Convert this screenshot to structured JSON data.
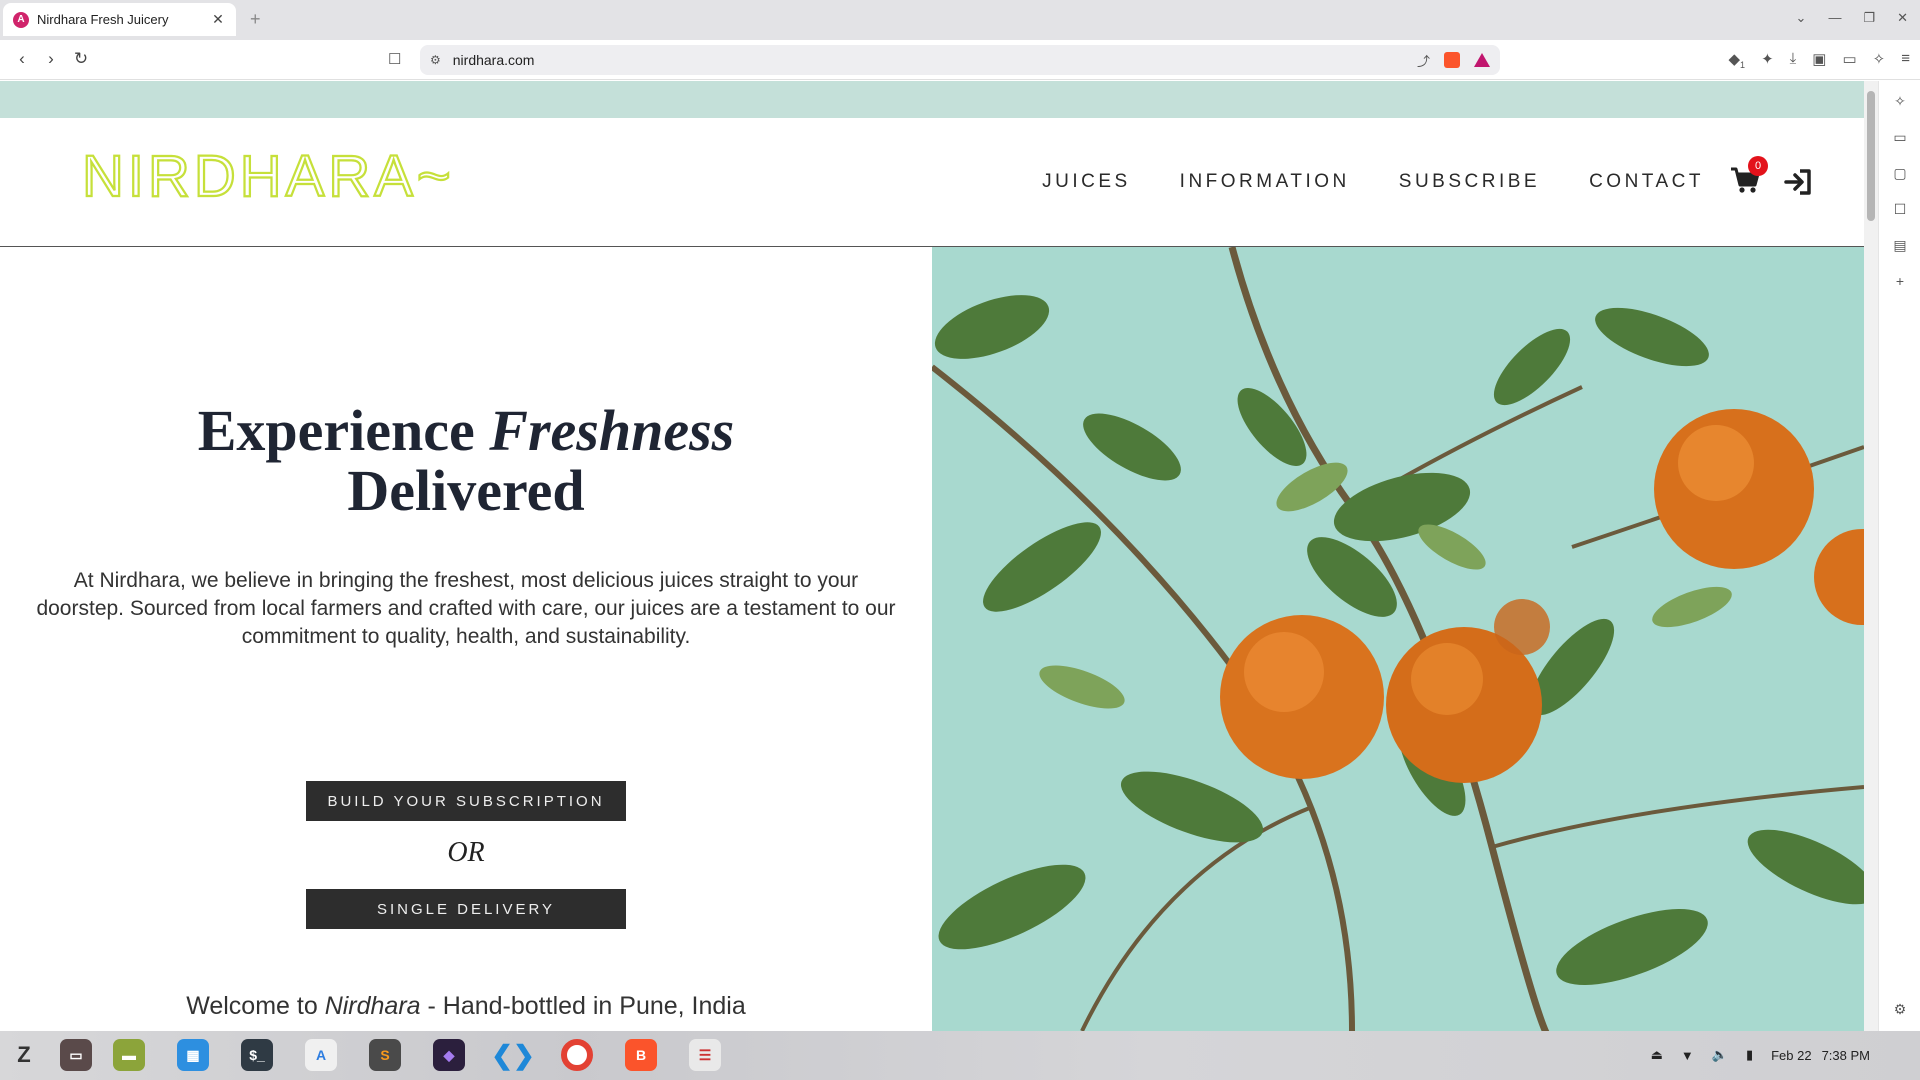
{
  "browser": {
    "tab_title": "Nirdhara Fresh Juicery",
    "tab_favicon": "A",
    "url": "nirdhara.com",
    "extension_badge": "1"
  },
  "site": {
    "logo_text": "NIRDHARA~",
    "logo_color": "#c6e03a",
    "nav": [
      "JUICES",
      "INFORMATION",
      "SUBSCRIBE",
      "CONTACT"
    ],
    "cart_count": "0",
    "announce_color": "#c4e0d9"
  },
  "hero": {
    "title_part1": "Experience ",
    "title_italic": "Freshness",
    "title_part2": "Delivered",
    "body": "At Nirdhara, we believe in bringing the freshest, most delicious juices straight to your doorstep. Sourced from local farmers and crafted with care, our juices are a testament to our commitment to quality, health, and sustainability.",
    "btn_subscription": "BUILD YOUR SUBSCRIPTION",
    "or_text": "OR",
    "btn_single": "SINGLE DELIVERY",
    "welcome_pre": "Welcome to ",
    "welcome_italic": "Nirdhara",
    "welcome_post": " - Hand-bottled in Pune, India",
    "image_subject": "oranges-on-tree"
  },
  "taskbar": {
    "date": "Feb 22",
    "time": "7:38 PM",
    "apps": [
      "zorin-menu",
      "files",
      "nemo",
      "store",
      "terminal",
      "text-editor",
      "sublime",
      "obsidian",
      "vscode",
      "chrome",
      "brave",
      "document-viewer"
    ]
  }
}
